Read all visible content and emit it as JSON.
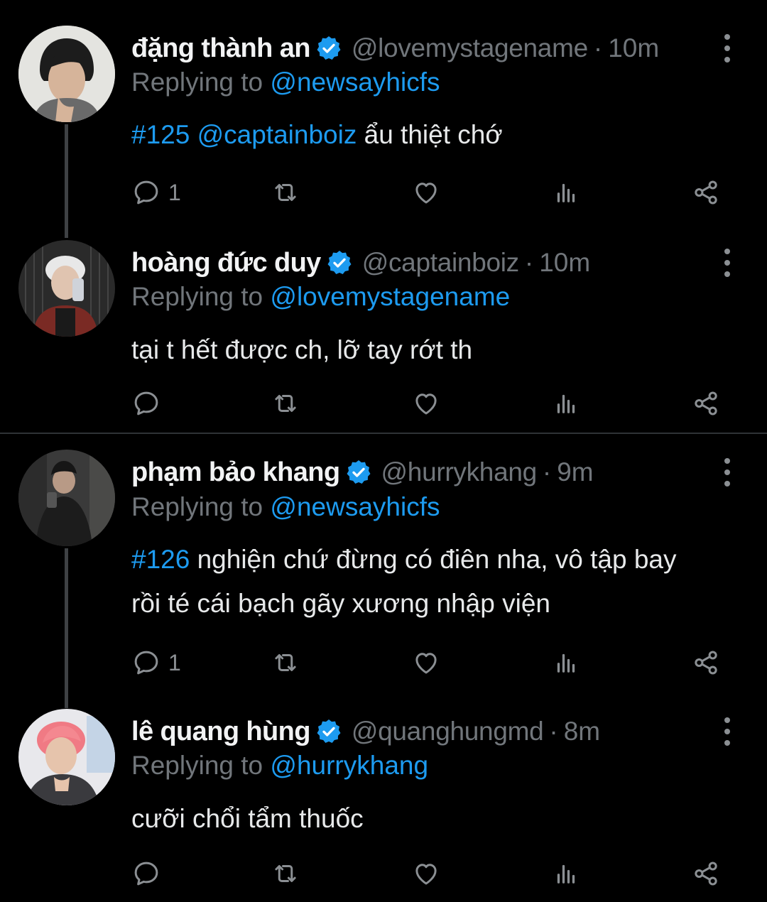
{
  "tweets": [
    {
      "name": "đặng thành an",
      "handle": "@lovemystagename",
      "time": "10m",
      "replying_label": "Replying to",
      "replying_to": "@newsayhicfs",
      "body_tag1": "#125",
      "body_tag2": "@captainboiz",
      "body_text": " ẩu thiệt chớ",
      "reply_count": "1"
    },
    {
      "name": "hoàng đức duy",
      "handle": "@captainboiz",
      "time": "10m",
      "replying_label": "Replying to",
      "replying_to": "@lovemystagename",
      "body_text": "tại t hết được ch, lỡ tay rớt th",
      "reply_count": ""
    },
    {
      "name": "phạm bảo khang",
      "handle": "@hurrykhang",
      "time": "9m",
      "replying_label": "Replying to",
      "replying_to": "@newsayhicfs",
      "body_tag1": "#126",
      "body_line1": " nghiện chứ đừng có điên nha, vô tập bay",
      "body_line2": "rồi té cái bạch gãy xương nhập viện",
      "reply_count": "1"
    },
    {
      "name": "lê quang hùng",
      "handle": "@quanghungmd",
      "time": "8m",
      "replying_label": "Replying to",
      "replying_to": "@hurrykhang",
      "body_text": "cưỡi chổi tẩm thuốc",
      "reply_count": ""
    }
  ],
  "separator": "·",
  "icons": [
    "reply-icon",
    "retweet-icon",
    "like-icon",
    "views-icon",
    "share-icon",
    "more-icon",
    "verified-badge-icon"
  ],
  "colors": {
    "link": "#1d9bf0",
    "muted": "#71767b",
    "background": "#000000"
  }
}
